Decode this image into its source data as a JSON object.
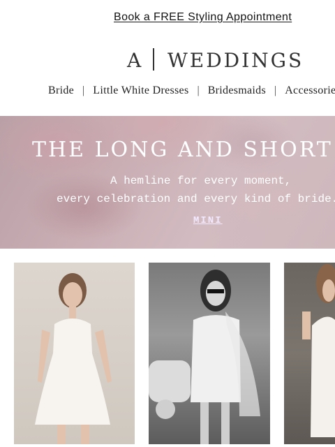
{
  "promo": {
    "link_text": "Book a FREE Styling Appointment"
  },
  "logo": {
    "letter": "A",
    "wordmark": "WEDDINGS"
  },
  "nav": {
    "items": [
      "Bride",
      "Little White Dresses",
      "Bridesmaids",
      "Accessories"
    ]
  },
  "hero": {
    "title": "THE LONG AND SHORT OF IT",
    "subtitle_line1": "A hemline for every moment,",
    "subtitle_line2": "every celebration and every kind of bride.",
    "link": "MINI"
  },
  "colors": {
    "text": "#222222",
    "hero_text": "#ffffff",
    "hero_link": "#f3e9ff"
  }
}
